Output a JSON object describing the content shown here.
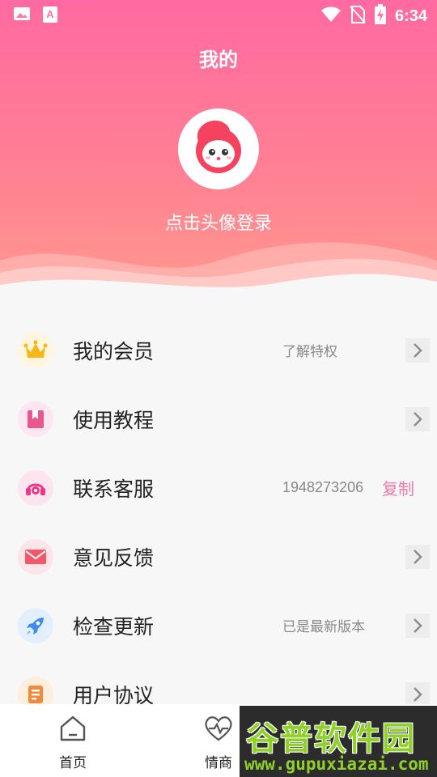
{
  "status_bar": {
    "time": "6:34",
    "icons": [
      "image-icon",
      "app-icon",
      "wifi-icon",
      "no-sim-icon",
      "battery-charging-icon"
    ]
  },
  "header": {
    "title": "我的",
    "login_text": "点击头像登录"
  },
  "menu": {
    "items": [
      {
        "label": "我的会员",
        "extra": "了解特权",
        "icon": "crown-icon"
      },
      {
        "label": "使用教程",
        "extra": "",
        "icon": "bookmark-icon"
      },
      {
        "label": "联系客服",
        "extra": "1948273206",
        "action": "复制",
        "icon": "headset-icon"
      },
      {
        "label": "意见反馈",
        "extra": "",
        "icon": "mail-icon"
      },
      {
        "label": "检查更新",
        "extra": "已是最新版本",
        "icon": "rocket-icon"
      },
      {
        "label": "用户协议",
        "extra": "",
        "icon": "document-icon"
      }
    ]
  },
  "bottom_nav": {
    "items": [
      {
        "label": "首页",
        "icon": "home-icon"
      },
      {
        "label": "情商",
        "icon": "heart-pulse-icon"
      }
    ]
  },
  "watermark": {
    "title": "谷普软件园",
    "url": "www.gupuxiazai.com"
  },
  "colors": {
    "gradient_top": "#ff6aa0",
    "gradient_bottom": "#ff9a8c",
    "accent": "#f07aa8"
  }
}
